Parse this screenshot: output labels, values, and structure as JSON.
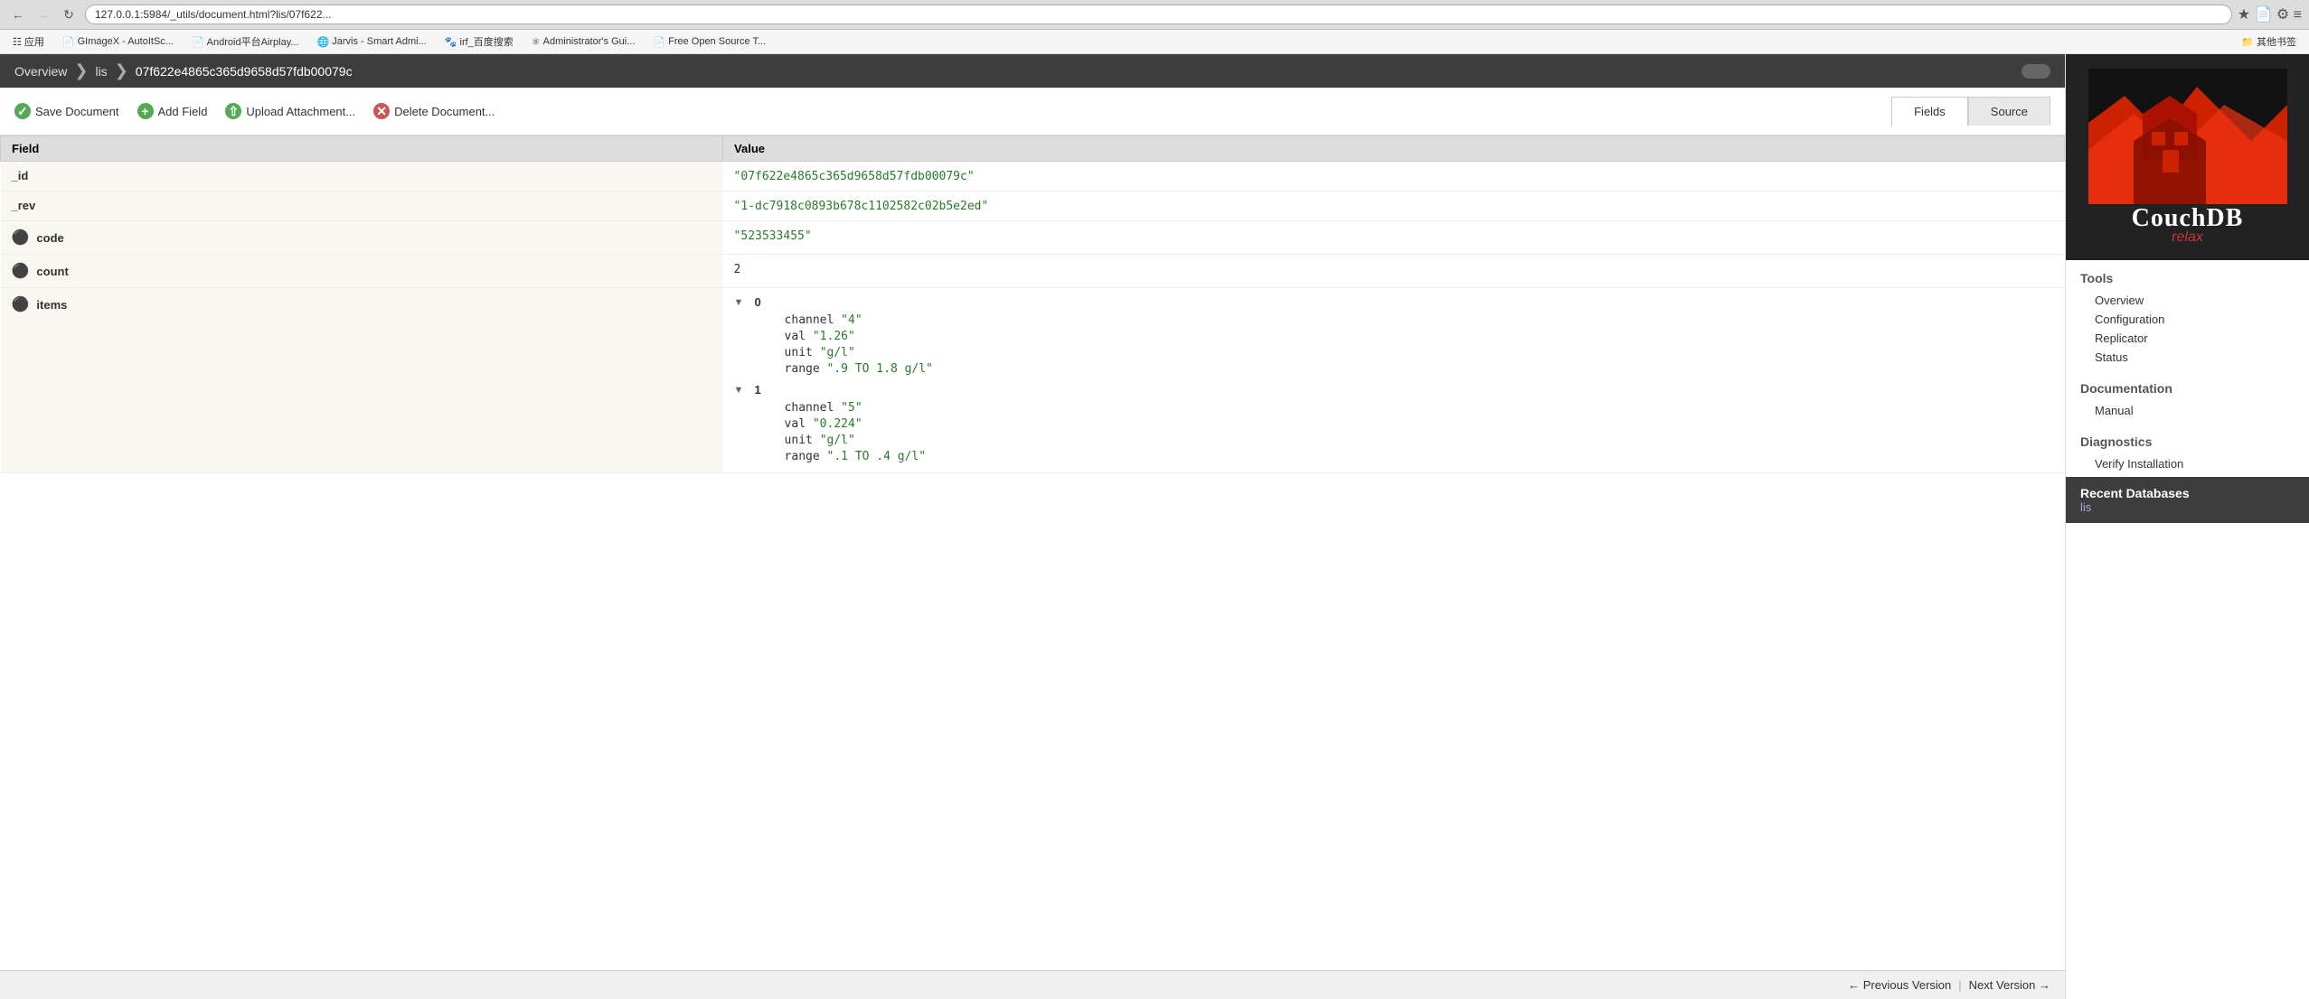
{
  "browser": {
    "url": "127.0.0.1:5984/_utils/document.html?lis/07f622...",
    "back_btn": "←",
    "forward_btn": "→",
    "reload_btn": "↻"
  },
  "bookmarks": [
    {
      "label": "应用",
      "icon": "apps"
    },
    {
      "label": "GImageX - AutoItSc...",
      "icon": "g"
    },
    {
      "label": "Android平台Airplay...",
      "icon": "doc"
    },
    {
      "label": "Jarvis - Smart Admi...",
      "icon": "w"
    },
    {
      "label": "irf_百度搜索",
      "icon": "paw"
    },
    {
      "label": "Administrator's Gui...",
      "icon": "ax"
    },
    {
      "label": "Free Open Source T...",
      "icon": "fo"
    },
    {
      "label": "其他书签",
      "icon": "folder"
    }
  ],
  "breadcrumb": {
    "overview": "Overview",
    "lis": "lis",
    "doc_id": "07f622e4865c365d9658d57fdb00079c"
  },
  "toolbar": {
    "save_label": "Save Document",
    "add_field_label": "Add Field",
    "upload_label": "Upload Attachment...",
    "delete_label": "Delete Document..."
  },
  "tabs": {
    "fields_label": "Fields",
    "source_label": "Source"
  },
  "table": {
    "field_header": "Field",
    "value_header": "Value"
  },
  "fields": [
    {
      "name": "_id",
      "value": "\"07f622e4865c365d9658d57fdb00079c\"",
      "type": "string",
      "deletable": false
    },
    {
      "name": "_rev",
      "value": "\"1-dc7918c0893b678c1102582c02b5e2ed\"",
      "type": "string",
      "deletable": false
    },
    {
      "name": "code",
      "value": "\"523533455\"",
      "type": "string",
      "deletable": true
    },
    {
      "name": "count",
      "value": "2",
      "type": "number",
      "deletable": true
    },
    {
      "name": "items",
      "value": "",
      "type": "array",
      "deletable": true,
      "items": [
        {
          "index": "0",
          "fields": [
            {
              "key": "channel",
              "value": "\"4\""
            },
            {
              "key": "val",
              "value": "\"1.26\""
            },
            {
              "key": "unit",
              "value": "\"g/l\""
            },
            {
              "key": "range",
              "value": "\".9 TO 1.8 g/l\""
            }
          ]
        },
        {
          "index": "1",
          "fields": [
            {
              "key": "channel",
              "value": "\"5\""
            },
            {
              "key": "val",
              "value": "\"0.224\""
            },
            {
              "key": "unit",
              "value": "\"g/l\""
            },
            {
              "key": "range",
              "value": "\".1 TO .4 g/l\""
            }
          ]
        }
      ]
    }
  ],
  "footer": {
    "prev_label": "← Previous Version",
    "next_label": "Next Version →",
    "separator": "|"
  },
  "sidebar": {
    "tools_title": "Tools",
    "tools_links": [
      "Overview",
      "Configuration",
      "Replicator",
      "Status"
    ],
    "docs_title": "Documentation",
    "docs_links": [
      "Manual"
    ],
    "diag_title": "Diagnostics",
    "diag_links": [
      "Verify Installation"
    ],
    "recent_title": "Recent Databases",
    "recent_db": "lis",
    "couch_text": "CouchDB",
    "relax_text": "relax"
  }
}
